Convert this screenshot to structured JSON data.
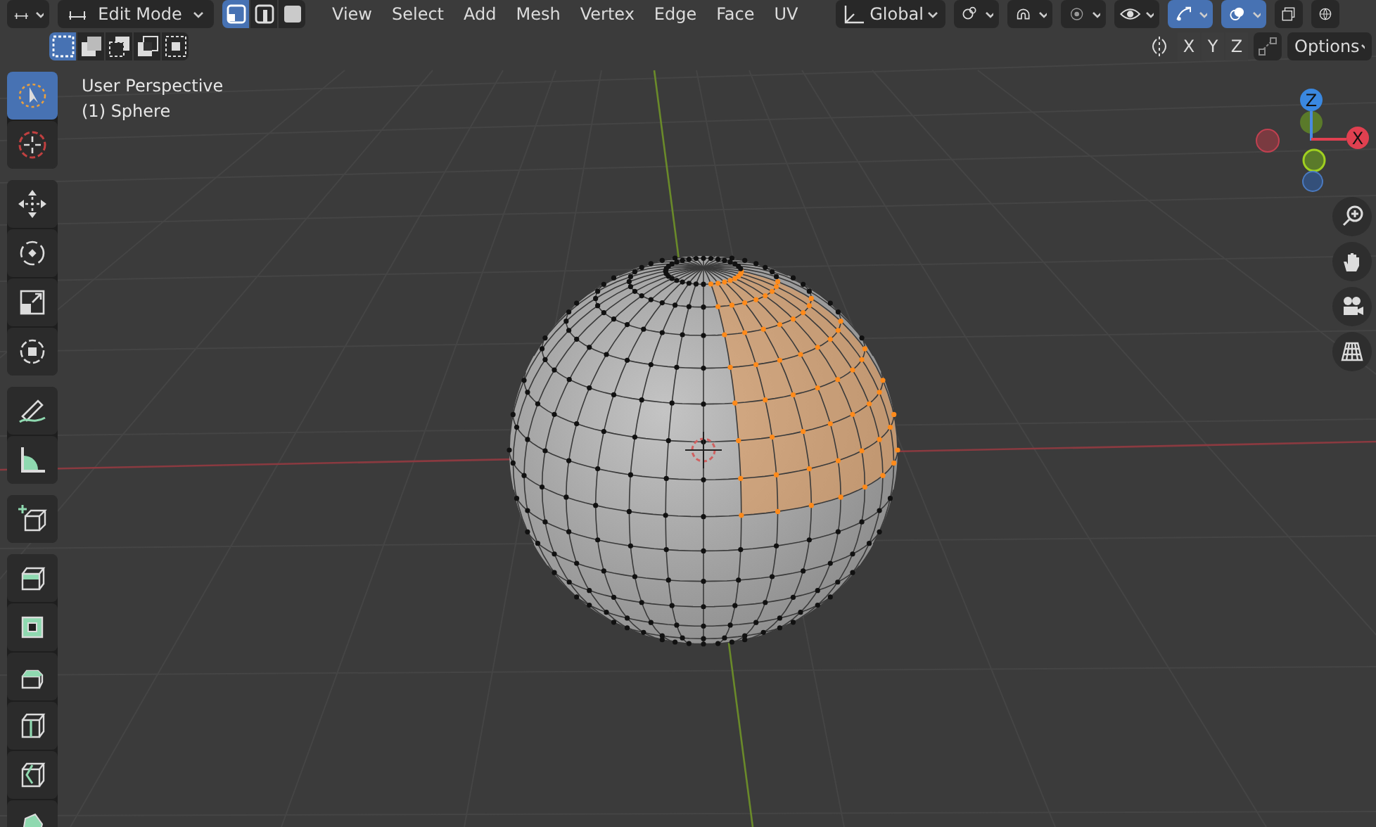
{
  "header": {
    "mode_menu": {
      "label": "Edit Mode"
    },
    "select_modes": [
      {
        "kind": "vertex",
        "selected": true
      },
      {
        "kind": "edge",
        "selected": false
      },
      {
        "kind": "face",
        "selected": false
      }
    ],
    "menus": [
      "View",
      "Select",
      "Add",
      "Mesh",
      "Vertex",
      "Edge",
      "Face",
      "UV"
    ],
    "orientation": {
      "label": "Global"
    },
    "toggles": [
      {
        "kind": "pivot",
        "on": false
      },
      {
        "kind": "snap",
        "on": false
      },
      {
        "kind": "proportional",
        "on": false
      },
      {
        "kind": "visibility",
        "on": false
      },
      {
        "kind": "gizmo",
        "on": true
      },
      {
        "kind": "overlay",
        "on": true
      },
      {
        "kind": "xray",
        "on": false
      },
      {
        "kind": "shading",
        "on": false
      }
    ]
  },
  "tool_settings": {
    "select_box_modes": [
      {
        "kind": "new",
        "selected": true
      },
      {
        "kind": "extend",
        "selected": false
      },
      {
        "kind": "subtract",
        "selected": false
      },
      {
        "kind": "invert",
        "selected": false
      },
      {
        "kind": "intersect",
        "selected": false
      }
    ],
    "mirror_axes": [
      {
        "label": "X",
        "selected": false
      },
      {
        "label": "Y",
        "selected": false
      },
      {
        "label": "Z",
        "selected": false
      }
    ],
    "options": {
      "label": "Options"
    }
  },
  "viewport": {
    "view_name": "User Perspective",
    "object_name": "(1) Sphere"
  },
  "toolbar": [
    {
      "tools": [
        {
          "kind": "select",
          "selected": true
        },
        {
          "kind": "cursor",
          "selected": false
        }
      ]
    },
    {
      "tools": [
        {
          "kind": "move",
          "selected": false
        },
        {
          "kind": "rotate",
          "selected": false
        },
        {
          "kind": "scale",
          "selected": false
        },
        {
          "kind": "transform",
          "selected": false
        }
      ]
    },
    {
      "tools": [
        {
          "kind": "annotate",
          "selected": false
        },
        {
          "kind": "measure",
          "selected": false
        }
      ]
    },
    {
      "tools": [
        {
          "kind": "add_cube",
          "selected": false
        }
      ]
    },
    {
      "tools": [
        {
          "kind": "extrude",
          "selected": false
        },
        {
          "kind": "inset",
          "selected": false
        },
        {
          "kind": "bevel",
          "selected": false
        },
        {
          "kind": "loop_cut",
          "selected": false
        },
        {
          "kind": "knife",
          "selected": false
        },
        {
          "kind": "poly_build",
          "selected": false
        }
      ]
    }
  ],
  "gizmo": {
    "axes": [
      {
        "label": "Z"
      },
      {
        "label": "X"
      }
    ]
  }
}
